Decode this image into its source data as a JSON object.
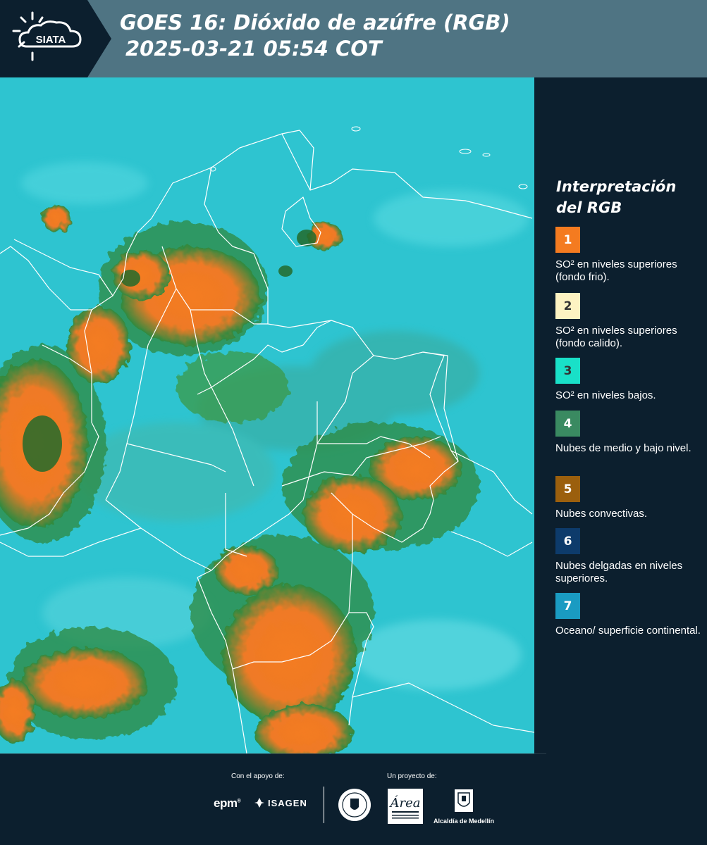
{
  "header": {
    "title_line1": "GOES 16: Dióxido de azúfre (RGB)",
    "title_line2": "2025-03-21 05:54 COT",
    "logo_text": "SIATA"
  },
  "legend": {
    "title_line1": "Interpretación",
    "title_line2": "del RGB",
    "items": [
      {
        "number": "1",
        "label": "SO² en niveles superiores (fondo frio).",
        "color": "#f47b20"
      },
      {
        "number": "2",
        "label": "SO² en niveles superiores (fondo calido).",
        "color": "#fdf3c2"
      },
      {
        "number": "3",
        "label": "SO² en niveles bajos.",
        "color": "#19e0c8"
      },
      {
        "number": "4",
        "label": "Nubes de medio y bajo nivel.",
        "color": "#3a8a61"
      },
      {
        "number": "5",
        "label": "Nubes convectivas.",
        "color": "#9b5f0d"
      },
      {
        "number": "6",
        "label": "Nubes delgadas en niveles superiores.",
        "color": "#0d3b6b"
      },
      {
        "number": "7",
        "label": "Oceano/ superficie continental.",
        "color": "#1a9bc2"
      }
    ]
  },
  "footer": {
    "support_label": "Con el apoyo de:",
    "project_label": "Un proyecto de:",
    "sponsors": [
      "epm",
      "ISAGEN"
    ],
    "partners": [
      "Área Metropolitana Valle de Aburrá",
      "Alcaldía de Medellín"
    ],
    "alcaldia_label": "Alcaldía de Medellín"
  },
  "map": {
    "background_color": "#2ec4d0",
    "cloud_color": "#f47b20",
    "green_color": "#2f8a3f",
    "border_color": "#ffffff"
  }
}
